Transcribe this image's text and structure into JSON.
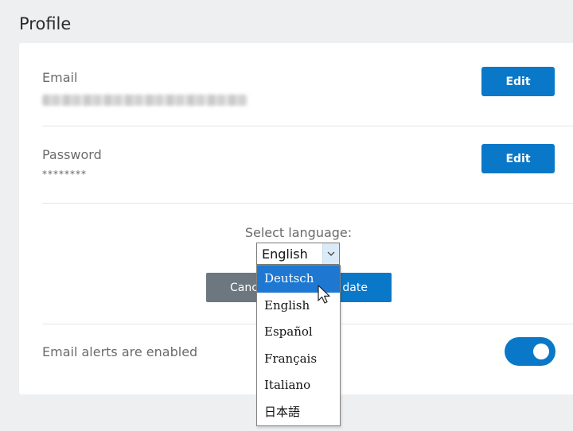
{
  "page": {
    "title": "Profile"
  },
  "email": {
    "label": "Email",
    "edit_label": "Edit"
  },
  "password": {
    "label": "Password",
    "value": "********",
    "edit_label": "Edit"
  },
  "language": {
    "label": "Select language:",
    "selected": "English",
    "options": [
      "Deutsch",
      "English",
      "Español",
      "Français",
      "Italiano",
      "日本語"
    ],
    "highlighted_option": "Deutsch",
    "cancel_label_visible": "Canc",
    "update_label_visible": "date"
  },
  "alerts": {
    "label": "Email alerts are enabled",
    "enabled": true
  },
  "colors": {
    "accent": "#0a78c8",
    "cancel": "#6d777f",
    "highlight": "#1e78d2",
    "background": "#eeeff1"
  },
  "icons": {
    "select_arrow": "chevron-down-icon",
    "cursor": "pointer-cursor-icon"
  }
}
